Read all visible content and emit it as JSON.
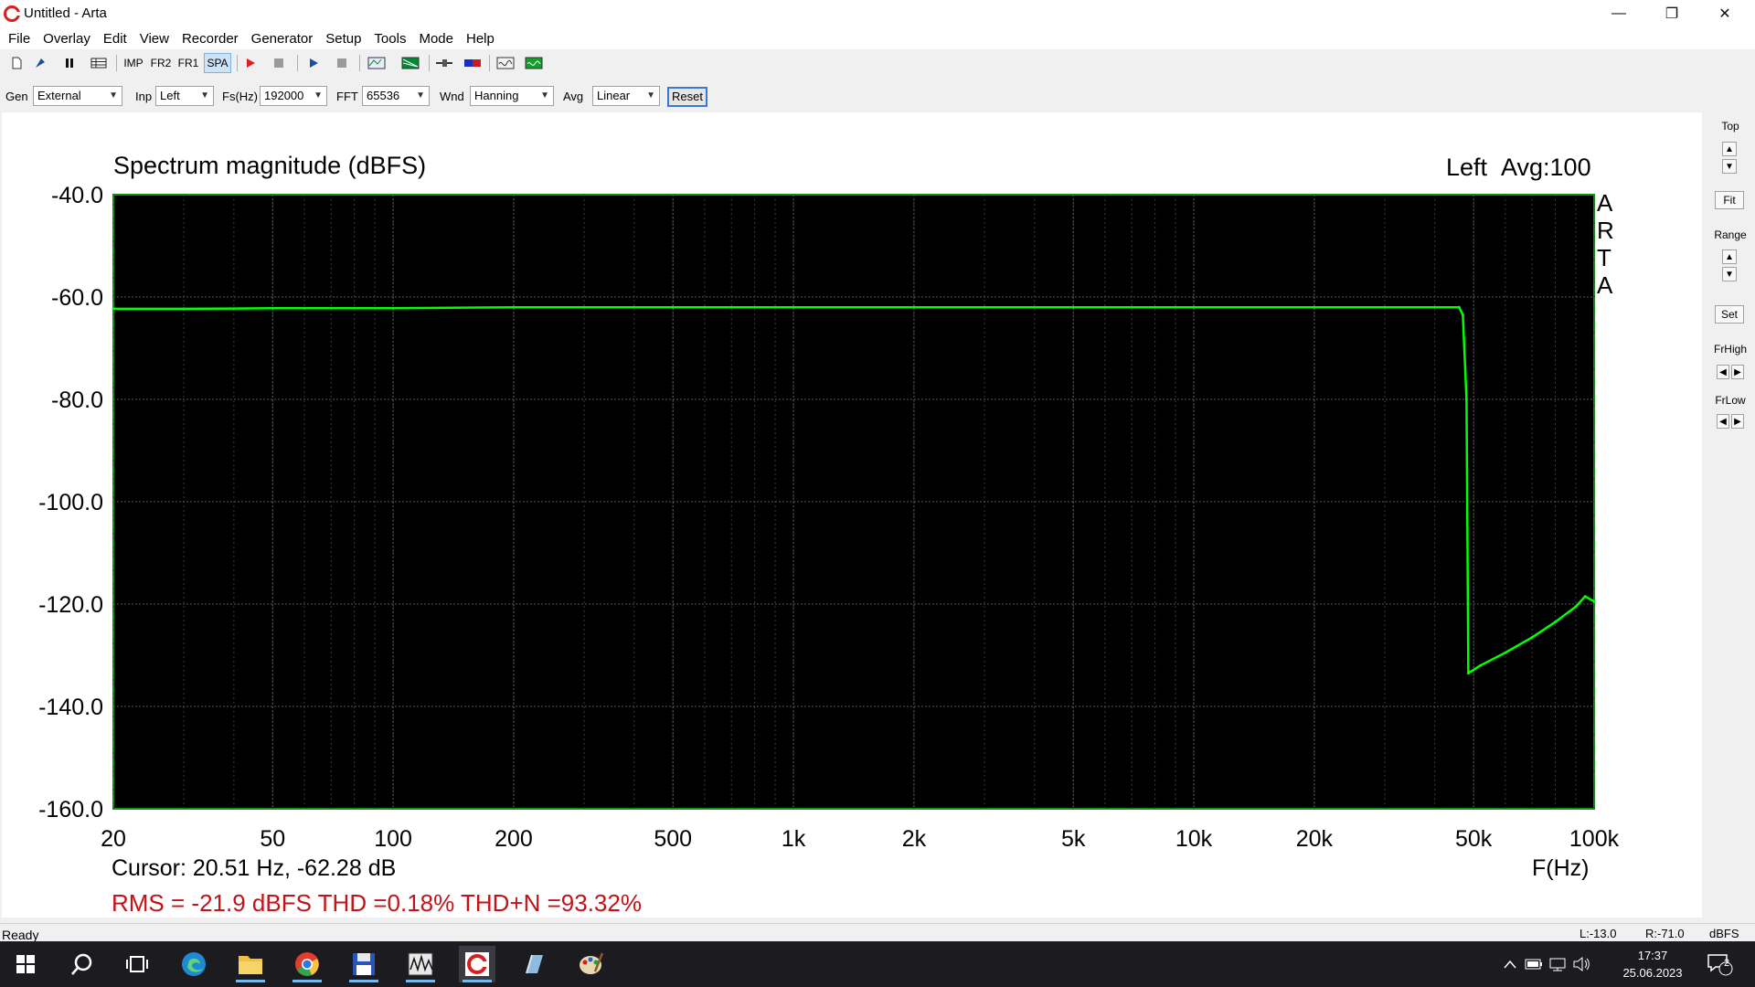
{
  "window": {
    "title": "Untitled - Arta",
    "controls": {
      "minimize": "—",
      "restore": "❐",
      "close": "✕"
    }
  },
  "menu": [
    "File",
    "Overlay",
    "Edit",
    "View",
    "Recorder",
    "Generator",
    "Setup",
    "Tools",
    "Mode",
    "Help"
  ],
  "toolbar": {
    "buttons": [
      {
        "name": "new-file-icon"
      },
      {
        "name": "open-file-icon"
      },
      {
        "name": "pause-icon"
      },
      {
        "name": "grid-view-icon"
      },
      {
        "name": "imp-button",
        "label": "IMP"
      },
      {
        "name": "fr2-button",
        "label": "FR2"
      },
      {
        "name": "fr1-button",
        "label": "FR1"
      },
      {
        "name": "spa-button",
        "label": "SPA"
      },
      {
        "name": "record-icon"
      },
      {
        "name": "stop-icon"
      },
      {
        "name": "play-icon"
      },
      {
        "name": "stop-2-icon"
      },
      {
        "name": "abc-icon"
      },
      {
        "name": "waveform-icon"
      },
      {
        "name": "slider-icon"
      },
      {
        "name": "color-bar-icon"
      },
      {
        "name": "scope-icon"
      },
      {
        "name": "green-monitor-icon"
      }
    ]
  },
  "options": {
    "gen": {
      "label": "Gen",
      "value": "External"
    },
    "inp": {
      "label": "Inp",
      "value": "Left"
    },
    "fs": {
      "label": "Fs(Hz)",
      "value": "192000"
    },
    "fft": {
      "label": "FFT",
      "value": "65536"
    },
    "wnd": {
      "label": "Wnd",
      "value": "Hanning"
    },
    "avg": {
      "label": "Avg",
      "value": "Linear"
    },
    "reset_label": "Reset"
  },
  "graph": {
    "title": "Spectrum magnitude (dBFS)",
    "channel": "Left",
    "avg": "Avg:100",
    "logo": [
      "A",
      "R",
      "T",
      "A"
    ],
    "cursor": "Cursor: 20.51 Hz, -62.28 dB",
    "xunit": "F(Hz)",
    "stats": "RMS =  -21.9 dBFS  THD =0.18%  THD+N =93.32%"
  },
  "chart_data": {
    "type": "line",
    "title": "Spectrum magnitude (dBFS)",
    "xlabel": "F(Hz)",
    "ylabel": "",
    "xscale": "log",
    "xlim": [
      20,
      100000
    ],
    "ylim": [
      -160,
      -40
    ],
    "grid": true,
    "x_ticks": [
      20,
      50,
      100,
      200,
      500,
      1000,
      2000,
      5000,
      10000,
      20000,
      50000,
      100000
    ],
    "x_tick_labels": [
      "20",
      "50",
      "100",
      "200",
      "500",
      "1k",
      "2k",
      "5k",
      "10k",
      "20k",
      "50k",
      "100k"
    ],
    "y_ticks": [
      -40,
      -60,
      -80,
      -100,
      -120,
      -140,
      -160
    ],
    "y_tick_labels": [
      "-40.0",
      "-60.0",
      "-80.0",
      "-100.0",
      "-120.0",
      "-140.0",
      "-160.0"
    ],
    "series": [
      {
        "name": "Left",
        "color": "#00ff00",
        "x": [
          20,
          30,
          50,
          100,
          200,
          500,
          1000,
          2000,
          5000,
          10000,
          20000,
          40000,
          46000,
          47000,
          48000,
          48500,
          52000,
          60000,
          70000,
          80000,
          90000,
          95000,
          100000
        ],
        "y": [
          -62.3,
          -62.3,
          -62.2,
          -62.2,
          -62.0,
          -62.0,
          -62.0,
          -62.0,
          -62.0,
          -62.0,
          -62.0,
          -62.0,
          -62.0,
          -63.5,
          -80.0,
          -133.5,
          -132.0,
          -129.5,
          -126.5,
          -123.5,
          -120.5,
          -118.5,
          -119.5
        ]
      }
    ]
  },
  "side_panel": {
    "top_label": "Top",
    "fit_label": "Fit",
    "range_label": "Range",
    "set_label": "Set",
    "frhigh_label": "FrHigh",
    "frlow_label": "FrLow"
  },
  "status": {
    "ready": "Ready",
    "l_level": "L:-13.0",
    "r_level": "R:-71.0",
    "unit": "dBFS"
  },
  "taskbar": {
    "time": "17:37",
    "date": "25.06.2023",
    "notifications": "2"
  }
}
